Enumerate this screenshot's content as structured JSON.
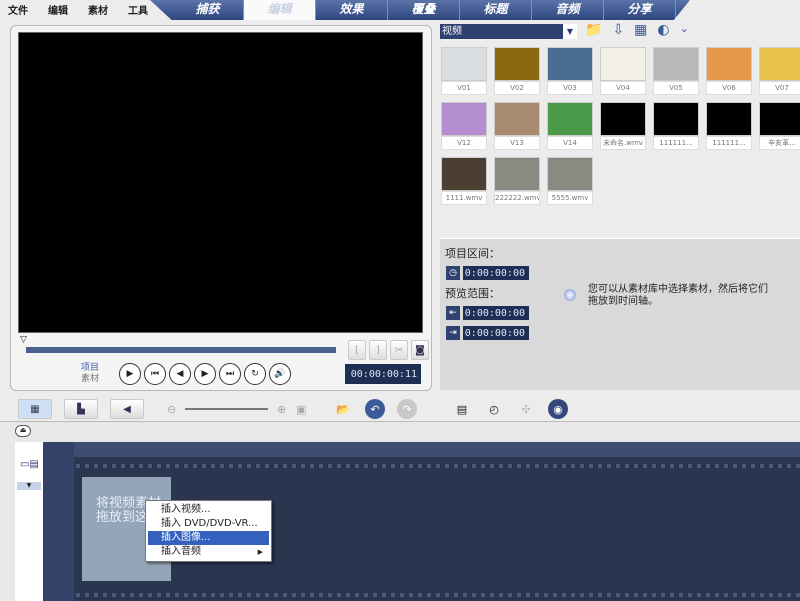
{
  "menu": [
    "文件",
    "编辑",
    "素材",
    "工具"
  ],
  "tabs": [
    {
      "label": "捕获"
    },
    {
      "label": "编辑",
      "active": true
    },
    {
      "label": "效果"
    },
    {
      "label": "覆叠"
    },
    {
      "label": "标题"
    },
    {
      "label": "音频"
    },
    {
      "label": "分享"
    }
  ],
  "preview": {
    "mode_project": "项目",
    "mode_clip": "素材",
    "timecode": "00:00:00:11",
    "trim_in": "[",
    "trim_out": "]"
  },
  "library": {
    "dropdown": "视频",
    "items": [
      {
        "label": "V01",
        "color": "#d8dde0"
      },
      {
        "label": "V02",
        "color": "#8a6a10"
      },
      {
        "label": "V03",
        "color": "#4b6d92"
      },
      {
        "label": "V04",
        "color": "#f3efe6"
      },
      {
        "label": "V05",
        "color": "#b8b8b8"
      },
      {
        "label": "V06",
        "color": "#e59a4a"
      },
      {
        "label": "V07",
        "color": "#e8c34e"
      },
      {
        "label": "V12",
        "color": "#b48cd0"
      },
      {
        "label": "V13",
        "color": "#a88a70"
      },
      {
        "label": "V14",
        "color": "#4a9a4a"
      },
      {
        "label": "未命名.wmv",
        "color": "#000000"
      },
      {
        "label": "111111...",
        "color": "#000000"
      },
      {
        "label": "111111...",
        "color": "#000000"
      },
      {
        "label": "辛亥革...",
        "color": "#000000"
      },
      {
        "label": "1111.wmv",
        "color": "#4a3f30"
      },
      {
        "label": "222222.wmv",
        "color": "#8a8a80"
      },
      {
        "label": "5555.wmv",
        "color": "#8a8a80"
      }
    ]
  },
  "options": {
    "project_duration_label": "项目区间：",
    "project_duration": "0:00:00:00",
    "preview_range_label": "预览范围：",
    "range_start": "0:00:00:00",
    "range_end": "0:00:00:00",
    "hint": "您可以从素材库中选择素材，然后将它们拖放到时间轴。"
  },
  "timeline": {
    "placeholder": "将视频素材拖放到这"
  },
  "context_menu": {
    "items": [
      {
        "label": "插入视频..."
      },
      {
        "label": "插入 DVD/DVD-VR..."
      },
      {
        "label": "插入图像...",
        "highlighted": true
      },
      {
        "label": "插入音频",
        "submenu": true
      }
    ]
  },
  "colors": {
    "tab_bar": "#2e4680",
    "timeline_bg": "#2a3550",
    "highlight": "#3461c0"
  }
}
